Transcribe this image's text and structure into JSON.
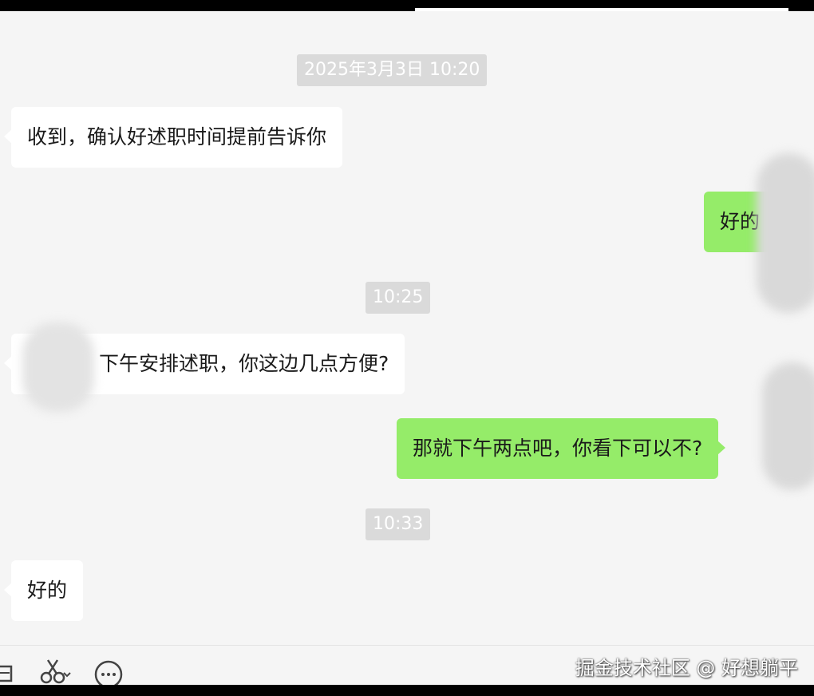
{
  "timestamps": [
    "2025年3月3日 10:20",
    "10:25",
    "10:33"
  ],
  "messages": [
    {
      "side": "left",
      "text": "收到，确认好述职时间提前告诉你"
    },
    {
      "side": "right",
      "text": "好的"
    },
    {
      "side": "left",
      "text": "下午安排述职，你这边几点方便?"
    },
    {
      "side": "right",
      "text": "那就下午两点吧，你看下可以不?"
    },
    {
      "side": "left",
      "text": "好的"
    }
  ],
  "toolbar": {
    "file_icon": "folder-icon",
    "scissors_icon": "scissors-icon",
    "chat_icon": "chat-history-icon"
  },
  "watermark": "掘金技术社区 @ 好想躺平",
  "colors": {
    "background": "#f5f5f5",
    "incoming_bubble": "#ffffff",
    "outgoing_bubble": "#95ec69",
    "time_chip": "#dadada"
  }
}
